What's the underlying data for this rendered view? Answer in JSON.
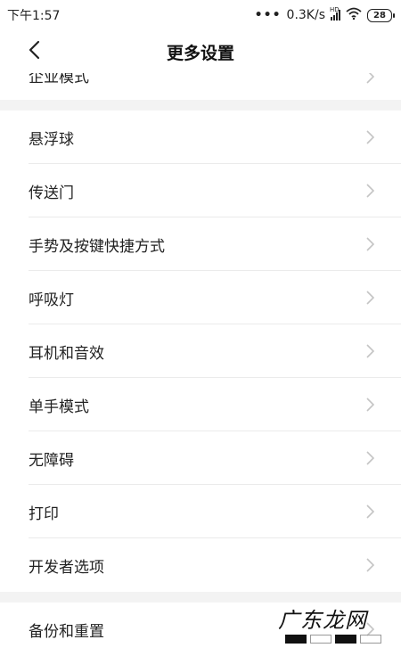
{
  "status_bar": {
    "time": "下午1:57",
    "more_dots": "•••",
    "network_speed": "0.3K/s",
    "signal_label": "HD",
    "battery_level": "28"
  },
  "nav": {
    "back_icon": "chevron-left-icon",
    "title": "更多设置"
  },
  "partial_item": {
    "label": "企业模式"
  },
  "items": [
    {
      "label": "悬浮球"
    },
    {
      "label": "传送门"
    },
    {
      "label": "手势及按键快捷方式"
    },
    {
      "label": "呼吸灯"
    },
    {
      "label": "耳机和音效"
    },
    {
      "label": "单手模式"
    },
    {
      "label": "无障碍"
    },
    {
      "label": "打印"
    },
    {
      "label": "开发者选项"
    }
  ],
  "bottom_item": {
    "label": "备份和重置"
  },
  "watermark": {
    "text": "广东龙网"
  },
  "colors": {
    "background": "#ffffff",
    "section_gap": "#f3f3f3",
    "divider": "#ebebeb",
    "chevron": "#c4c4c4",
    "text": "#222222"
  }
}
